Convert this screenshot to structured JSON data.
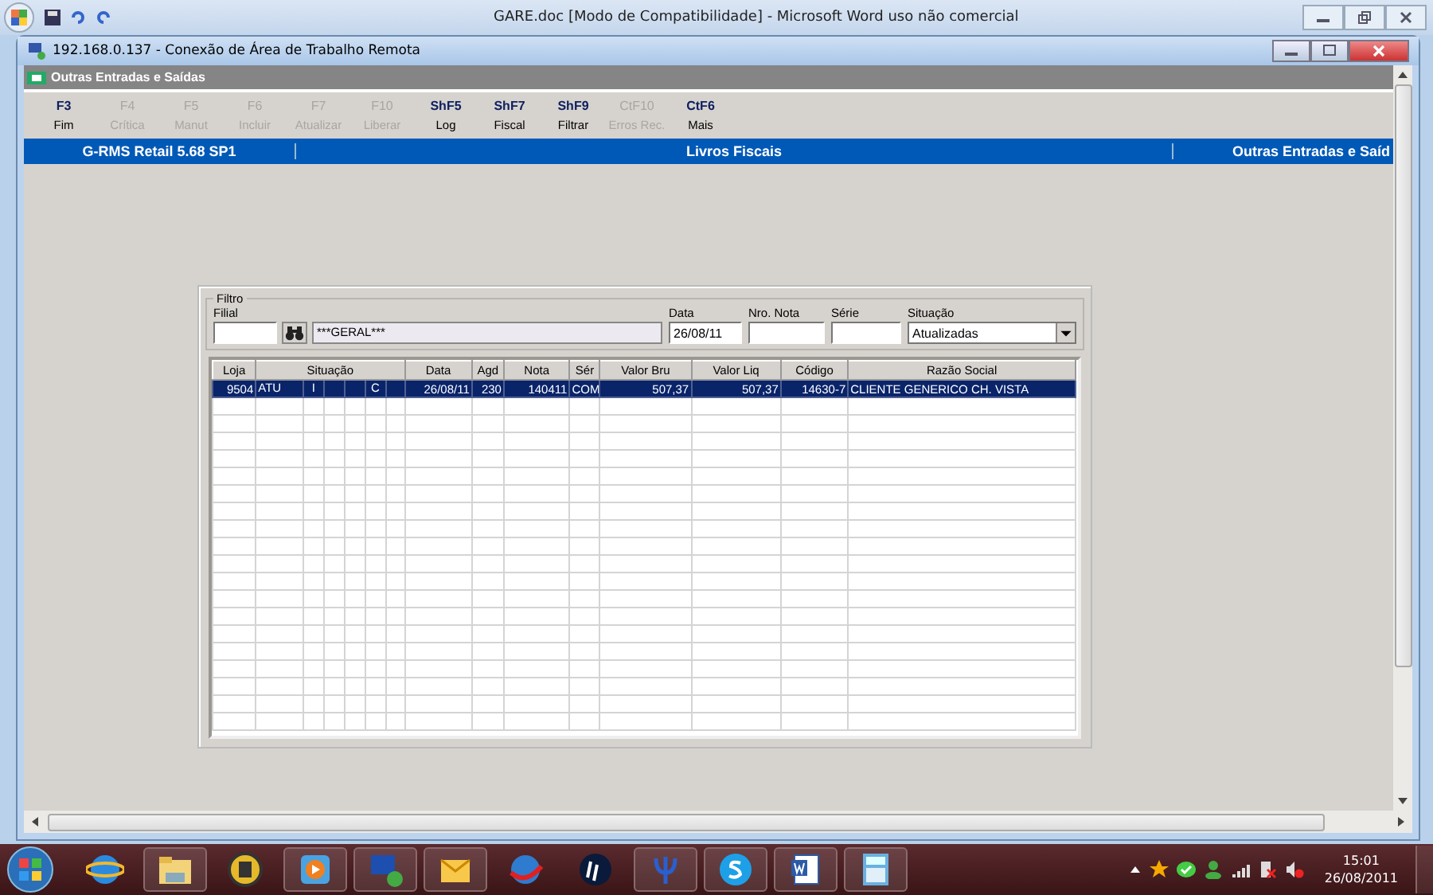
{
  "word_window": {
    "title": "GARE.doc [Modo de Compatibilidade] - Microsoft Word uso não comercial"
  },
  "remote_window": {
    "title": "192.168.0.137 - Conexão de Área de Trabalho Remota"
  },
  "app": {
    "title": "Outras Entradas e Saídas",
    "toolbar": [
      {
        "key": "F3",
        "label": "Fim",
        "disabled": false
      },
      {
        "key": "F4",
        "label": "Crítica",
        "disabled": true
      },
      {
        "key": "F5",
        "label": "Manut",
        "disabled": true
      },
      {
        "key": "F6",
        "label": "Incluir",
        "disabled": true
      },
      {
        "key": "F7",
        "label": "Atualizar",
        "disabled": true
      },
      {
        "key": "F10",
        "label": "Liberar",
        "disabled": true
      },
      {
        "key": "ShF5",
        "label": "Log",
        "disabled": false
      },
      {
        "key": "ShF7",
        "label": "Fiscal",
        "disabled": false
      },
      {
        "key": "ShF9",
        "label": "Filtrar",
        "disabled": false
      },
      {
        "key": "CtF10",
        "label": "Erros Rec.",
        "disabled": true
      },
      {
        "key": "CtF6",
        "label": "Mais",
        "disabled": false
      }
    ],
    "banner": [
      "G-RMS Retail 5.68 SP1",
      "Livros Fiscais",
      "Outras Entradas e Saíd"
    ],
    "filter": {
      "title": "Filtro",
      "filial_label": "Filial",
      "store_name": "***GERAL***",
      "data_label": "Data",
      "data_value": "26/08/11",
      "nota_label": "Nro. Nota",
      "serie_label": "Série",
      "situacao_label": "Situação",
      "situacao_value": "Atualizadas"
    },
    "table": {
      "columns": [
        {
          "label": "Loja"
        },
        {
          "label": "Situação"
        },
        {
          "label": "Data"
        },
        {
          "label": "Agd"
        },
        {
          "label": "Nota"
        },
        {
          "label": "Sér"
        },
        {
          "label": "Valor Bru"
        },
        {
          "label": "Valor Liq"
        },
        {
          "label": "Código"
        },
        {
          "label": "Razão Social"
        }
      ],
      "rows": [
        {
          "selected": true,
          "cells": [
            "9504",
            [
              "ATU",
              "I",
              "C"
            ],
            "26/08/11",
            "230",
            "140411",
            "COM",
            "507,37",
            "507,37",
            "14630-7",
            "CLIENTE GENERICO CH. VISTA"
          ]
        }
      ]
    }
  },
  "taskbar": {
    "apps": [
      {
        "running": false
      },
      {
        "running": true
      },
      {
        "running": false
      },
      {
        "running": true
      },
      {
        "running": true
      },
      {
        "running": true
      },
      {
        "running": false
      },
      {
        "running": false
      },
      {
        "running": true
      },
      {
        "running": true
      },
      {
        "running": true
      },
      {
        "running": true
      }
    ],
    "time": "15:01",
    "date": "26/08/2011"
  }
}
